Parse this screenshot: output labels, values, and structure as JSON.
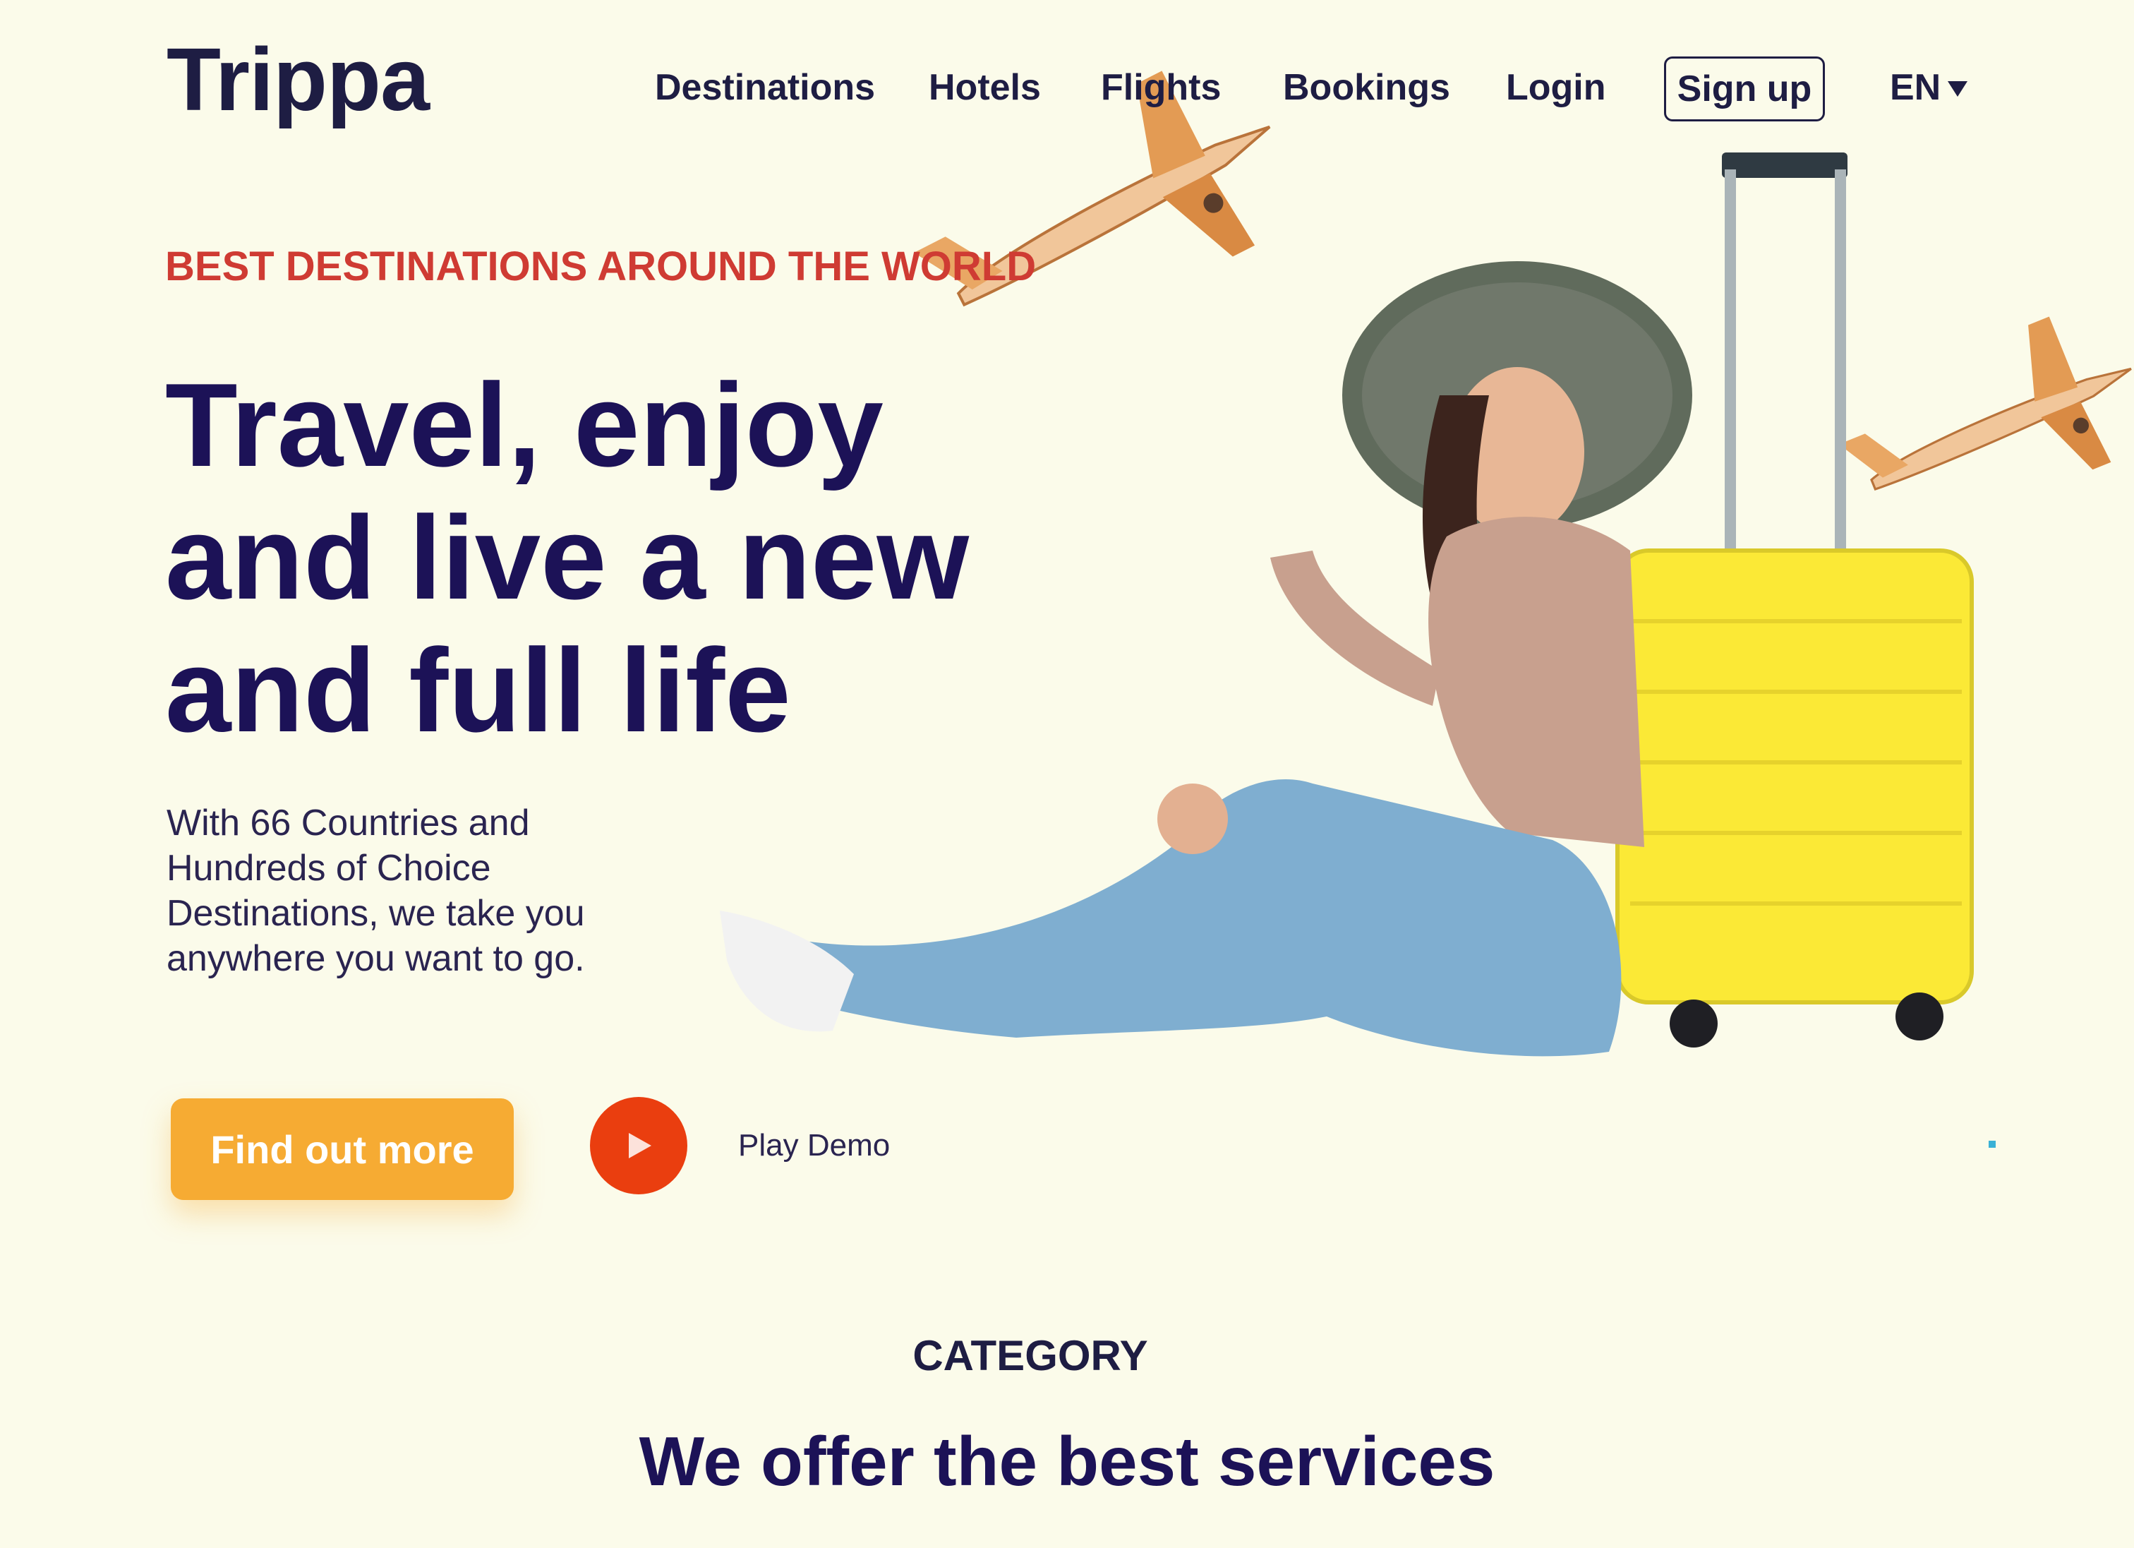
{
  "brand": {
    "logo": "Trippa"
  },
  "nav": {
    "links": [
      "Destinations",
      "Hotels",
      "Flights",
      "Bookings",
      "Login"
    ],
    "signup": "Sign up",
    "language": "EN"
  },
  "hero": {
    "eyebrow": "BEST DESTINATIONS AROUND THE WORLD",
    "headline_lines": [
      "Travel, enjoy",
      "and live a new",
      "and full life"
    ],
    "subcopy": "With 66 Countries and Hundreds of Choice Destinations, we take you anywhere you want to go.",
    "cta_label": "Find out more",
    "play_label": "Play Demo"
  },
  "category": {
    "eyebrow": "CATEGORY",
    "title": "We offer the best services"
  },
  "colors": {
    "background": "#fbfbea",
    "accent_red": "#cf3b33",
    "cta_orange": "#f6ab33",
    "play_red": "#ea3e0f",
    "navy": "#1c1257",
    "suitcase_yellow": "#fbe936"
  },
  "icons": {
    "play": "play-icon",
    "caret": "caret-down-icon"
  }
}
